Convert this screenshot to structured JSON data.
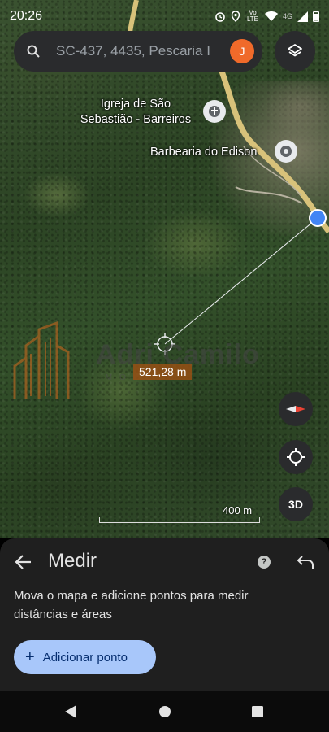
{
  "status_bar": {
    "time": "20:26",
    "network": "Vo LTE",
    "signal_type": "4G"
  },
  "search": {
    "text": "SC-437, 4435, Pescaria I",
    "avatar_letter": "J"
  },
  "map": {
    "places": [
      {
        "name_line1": "Igreja de São",
        "name_line2": "Sebastião - Barreiros"
      },
      {
        "name": "Barbearia do Edison"
      }
    ],
    "measurement": "521,28 m",
    "scale": "400 m",
    "watermark": {
      "name": "Adri Camilo",
      "sub": "IMÓVEIS"
    }
  },
  "controls": {
    "three_d": "3D"
  },
  "sheet": {
    "title": "Medir",
    "description": "Mova o mapa e adicione pontos para medir distâncias e áreas",
    "add_button": "Adicionar ponto",
    "help": "?"
  },
  "colors": {
    "accent_button": "#a8c7fa",
    "avatar": "#f06a2a",
    "measure_label": "#964f14",
    "location_dot": "#4285f4"
  }
}
